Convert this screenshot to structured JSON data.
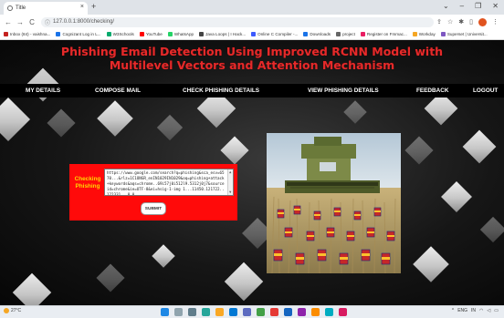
{
  "browser": {
    "tab_title": "Title",
    "tab_close": "×",
    "new_tab": "+",
    "url": "127.0.0.1:8000/checking/",
    "window_controls": [
      "⌄",
      "–",
      "❐",
      "✕"
    ],
    "nav": {
      "back": "←",
      "forward": "→",
      "reload": "C"
    },
    "bookmarks": [
      {
        "label": "Inbox (84) - vaishna...",
        "color": "#c5221f"
      },
      {
        "label": "Cognizant Log in L...",
        "color": "#1a73e8"
      },
      {
        "label": "W3Schools",
        "color": "#04aa6d"
      },
      {
        "label": "YouTube",
        "color": "#ff0000"
      },
      {
        "label": "WhatsApp",
        "color": "#25d366"
      },
      {
        "label": "Java Loops | I Hack...",
        "color": "#444444"
      },
      {
        "label": "Online C Compiler -...",
        "color": "#3d5afe"
      },
      {
        "label": "Downloads",
        "color": "#1a73e8"
      },
      {
        "label": "project",
        "color": "#666666"
      },
      {
        "label": "Register on Fmmac...",
        "color": "#e91e63"
      },
      {
        "label": "Workday",
        "color": "#f5a623"
      },
      {
        "label": "Superset | Universit...",
        "color": "#7e57c2"
      }
    ]
  },
  "site": {
    "title": "Phishing Email Detection Using Improved RCNN Model with Multilevel Vectors and Attention Mechanism",
    "title_color": "#e52a2a",
    "nav": [
      "MY DETAILS",
      "COMPOSE MAIL",
      "CHECK PHISHING DETAILS",
      "VIEW PHISHING DETAILS",
      "FEEDBACK",
      "LOGOUT"
    ],
    "form": {
      "label": "Checking Phishing",
      "input_value": "https://www.google.com/search?q=phishing&sca_esv=6570...&rlz=1C1ONGR_enIN1029IN1029&oq=phishing+attack+keywords&aqs=chrome..69i57j0i512l9.5312j0j7&sourceid=chrome&ie=UTF-8&ei=hsig-1-img 1...11450.121722..122331...0.0",
      "submit_label": "SUBMIT"
    },
    "image_alt_name": "harvester-in-field-photo"
  },
  "taskbar": {
    "weather": "27°C",
    "tray": [
      "ENG",
      "IN",
      "^"
    ]
  }
}
